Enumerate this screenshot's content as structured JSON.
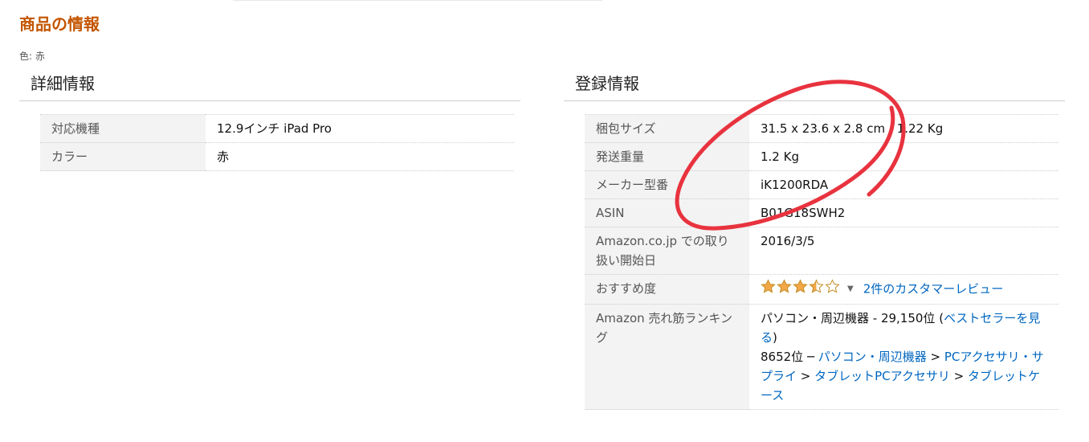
{
  "page": {
    "section_title": "商品の情報",
    "color_note": "色: 赤"
  },
  "details": {
    "heading": "詳細情報",
    "rows": [
      {
        "label": "対応機種",
        "value": "12.9インチ iPad Pro"
      },
      {
        "label": "カラー",
        "value": "赤"
      }
    ]
  },
  "registration": {
    "heading": "登録情報",
    "package_size": {
      "label": "梱包サイズ",
      "value": "31.5 x 23.6 x 2.8 cm ; 1.22 Kg"
    },
    "shipping_weight": {
      "label": "発送重量",
      "value": "1.2 Kg"
    },
    "model_number": {
      "label": "メーカー型番",
      "value": "iK1200RDA"
    },
    "asin": {
      "label": "ASIN",
      "value": "B01G18SWH2"
    },
    "release_date": {
      "label": "Amazon.co.jp での取り扱い開始日",
      "value": "2016/3/5"
    },
    "rating": {
      "label": "おすすめ度",
      "stars": 3.5,
      "max_stars": 5,
      "review_link": "2件のカスタマーレビュー",
      "star_color": "#f3a847"
    },
    "ranking": {
      "label": "Amazon 売れ筋ランキング",
      "line1_prefix": "パソコン・周辺機器 - 29,150位 (",
      "line1_link": "ベストセラーを見る",
      "line1_suffix": ")",
      "line2_prefix": "8652位 ─ ",
      "path": [
        "パソコン・周辺機器",
        "PCアクセサリ・サプライ",
        "タブレットPCアクセサリ",
        "タブレットケース"
      ],
      "separator": " > "
    }
  },
  "colors": {
    "title_orange": "#c45500",
    "link_blue": "#0066c0",
    "label_bg": "#f3f3f3",
    "annotation_red": "#e8333f"
  }
}
